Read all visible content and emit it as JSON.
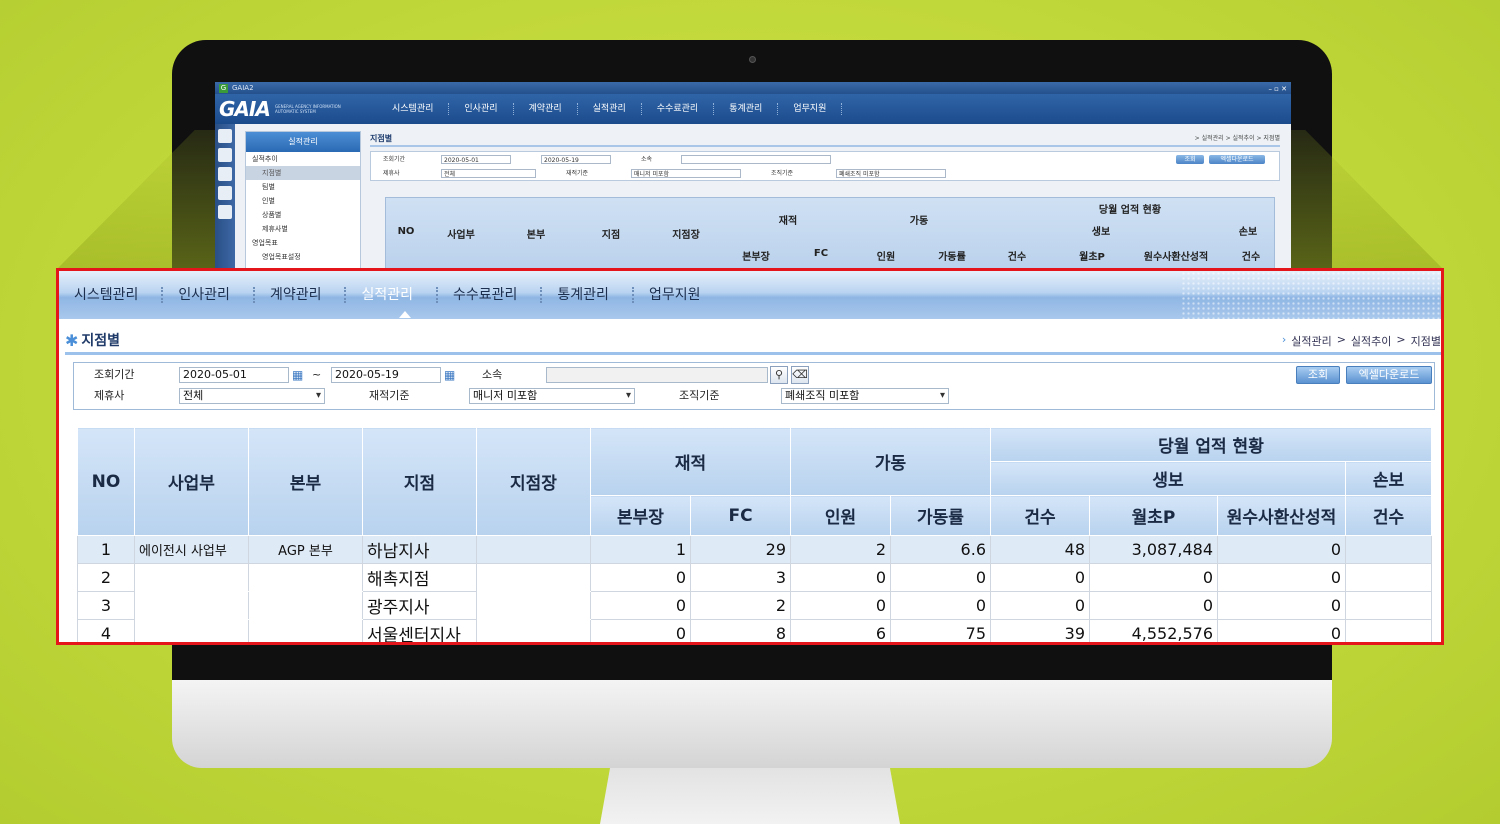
{
  "small_screen": {
    "window_title": "GAIA2",
    "logo": "GAIA",
    "logo_sub": "GENERAL AGENCY INFORMATION AUTOMATIC SYSTEM",
    "menu": [
      "시스템관리",
      "인사관리",
      "계약관리",
      "실적관리",
      "수수료관리",
      "통계관리",
      "업무지원"
    ],
    "nav_header": "실적관리",
    "nav_items": [
      "실적추이",
      "지점별",
      "팀별",
      "인별",
      "상품별",
      "제휴사별",
      "영업목표",
      "영업목표설정"
    ],
    "page_title": "지점별",
    "breadcrumb": "> 실적관리 > 실적추이 > 지점별",
    "filter": {
      "period_label": "조회기간",
      "date_from": "2020-05-01",
      "date_to": "2020-05-19",
      "org_label": "소속",
      "partner_label": "제휴사",
      "partner_value": "전체",
      "basis_label": "재적기준",
      "basis_value": "매니저 미포함",
      "org_basis_label": "조직기준",
      "org_basis_value": "폐쇄조직 미포함",
      "search_btn": "조회",
      "excel_btn": "엑셀다운로드"
    },
    "grid_headers": [
      "NO",
      "사업부",
      "본부",
      "지점",
      "지점장",
      "재적",
      "가동",
      "당월 업적 현황",
      "생보",
      "손보",
      "본부장",
      "FC",
      "인원",
      "가동률",
      "건수",
      "월초P",
      "원수사환산성적",
      "건수"
    ]
  },
  "zoom": {
    "menu": [
      {
        "label": "시스템관리",
        "active": false
      },
      {
        "label": "인사관리",
        "active": false
      },
      {
        "label": "계약관리",
        "active": false
      },
      {
        "label": "실적관리",
        "active": true
      },
      {
        "label": "수수료관리",
        "active": false
      },
      {
        "label": "통계관리",
        "active": false
      },
      {
        "label": "업무지원",
        "active": false
      }
    ],
    "page_title": "지점별",
    "breadcrumb": [
      "실적관리",
      "실적추이",
      "지점별"
    ],
    "filter": {
      "period_label": "조회기간",
      "date_from": "2020-05-01",
      "tilde": "~",
      "date_to": "2020-05-19",
      "org_label": "소속",
      "org_value": "",
      "partner_label": "제휴사",
      "partner_value": "전체",
      "basis_label": "재적기준",
      "basis_value": "매니저 미포함",
      "org_basis_label": "조직기준",
      "org_basis_value": "폐쇄조직 미포함",
      "search_btn": "조회",
      "excel_btn": "엑셀다운로드"
    },
    "table": {
      "headers": {
        "no": "NO",
        "division": "사업부",
        "hq": "본부",
        "branch": "지점",
        "branch_mgr": "지점장",
        "enrolled": "재적",
        "active": "가동",
        "monthly": "당월 업적 현황",
        "life": "생보",
        "nonlife": "손보",
        "hq_mgr": "본부장",
        "fc": "FC",
        "headcount": "인원",
        "active_rate": "가동률",
        "life_count": "건수",
        "monthly_p": "월초P",
        "converted": "원수사환산성적",
        "nonlife_count": "건수"
      },
      "rows": [
        {
          "no": "1",
          "division": "에이전시 사업부",
          "hq": "AGP 본부",
          "branch": "하남지사",
          "branch_mgr": "",
          "hq_mgr": "1",
          "fc": "29",
          "headcount": "2",
          "active_rate": "6.6",
          "life_count": "48",
          "monthly_p": "3,087,484",
          "converted": "0",
          "nonlife_count": ""
        },
        {
          "no": "2",
          "division": "",
          "hq": "",
          "branch": "해촉지점",
          "branch_mgr": "",
          "hq_mgr": "0",
          "fc": "3",
          "headcount": "0",
          "active_rate": "0",
          "life_count": "0",
          "monthly_p": "0",
          "converted": "0",
          "nonlife_count": ""
        },
        {
          "no": "3",
          "division": "",
          "hq": "",
          "branch": "광주지사",
          "branch_mgr": "",
          "hq_mgr": "0",
          "fc": "2",
          "headcount": "0",
          "active_rate": "0",
          "life_count": "0",
          "monthly_p": "0",
          "converted": "0",
          "nonlife_count": ""
        },
        {
          "no": "4",
          "division": "",
          "hq": "",
          "branch": "서울센터지사",
          "branch_mgr": "",
          "hq_mgr": "0",
          "fc": "8",
          "headcount": "6",
          "active_rate": "75",
          "life_count": "39",
          "monthly_p": "4,552,576",
          "converted": "0",
          "nonlife_count": ""
        }
      ]
    }
  }
}
